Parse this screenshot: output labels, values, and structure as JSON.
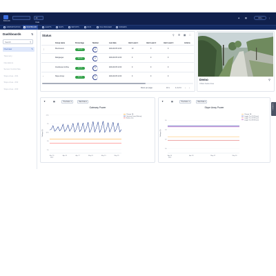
{
  "header": {
    "brand_name": "BRAND",
    "selector_value": "",
    "selector_2_value": "All Data",
    "language": "EN",
    "user_label": "FR"
  },
  "nav": {
    "items": [
      {
        "label": "ADMINISTRATION",
        "active": false
      },
      {
        "label": "DASHBOARD",
        "active": true
      },
      {
        "label": "ALERTS",
        "active": false
      },
      {
        "label": "MAPS",
        "active": false
      },
      {
        "label": "REPORTS",
        "active": false
      },
      {
        "label": "DATA",
        "active": false
      },
      {
        "label": "FILE MANAGER",
        "active": false
      },
      {
        "label": "SCREENS",
        "active": false
      }
    ]
  },
  "sidebar": {
    "title": "Dashboards",
    "search_placeholder": "Search",
    "items": [
      {
        "label": "Overview",
        "active": true
      },
      {
        "label": "Telemetry",
        "active": false
      },
      {
        "label": "Operations",
        "active": false
      },
      {
        "label": "Sensor Control Site",
        "active": false
      },
      {
        "label": "Slope Area - 001",
        "active": false
      },
      {
        "label": "Slope Area - 002",
        "active": false
      },
      {
        "label": "Slope Area - 003",
        "active": false
      }
    ]
  },
  "status": {
    "title": "Status",
    "columns": [
      "Group name",
      "Percentage",
      "Number",
      "Last data",
      "Alert Level 1",
      "Alert Level 2",
      "Alert Level 3",
      "Actions"
    ],
    "rows": [
      {
        "name": "Piezometers",
        "percentage": "100.0%",
        "number": "4/4",
        "last_data": "2022-09-05 12:00",
        "l1": "12",
        "l2": "0",
        "l3": "0"
      },
      {
        "name": "Raingauges",
        "percentage": "100.0%",
        "number": "1/1",
        "last_data": "2022-09-05 12:00",
        "l1": "0",
        "l2": "0",
        "l3": "0"
      },
      {
        "name": "Crackmeter Archive",
        "percentage": "100.0%",
        "number": "3/3",
        "last_data": "2022-09-05 12:00",
        "l1": "0",
        "l2": "0",
        "l3": "0"
      },
      {
        "name": "Slope Arrays",
        "percentage": "100.0%",
        "number": "2/2",
        "last_data": "2022-09-05 12:00",
        "l1": "0",
        "l2": "0",
        "l3": "0"
      }
    ],
    "pagination": {
      "rows_per_page_label": "Rows per page:",
      "rows_per_page": "10",
      "range": "1-4 of 4"
    }
  },
  "demo_card": {
    "title": "Demo",
    "subtitle": "Urban Aware Area"
  },
  "charts_meta": {
    "timeframe_label": "Timeframe",
    "range_label": "Raw Data",
    "feedback_tab": "Feedback"
  },
  "chart_data": [
    {
      "type": "line",
      "title": "Gateway Power",
      "ylabel": "Voltage (V)",
      "xlabel": "",
      "x_ticks": [
        "Mar 20 2022",
        "Apr 03",
        "Apr 17",
        "May 01",
        "May 15",
        "May 29"
      ],
      "y_ticks": [
        "7.5",
        "10",
        "12.5",
        "15",
        "17.5"
      ],
      "ylim": [
        6.5,
        18
      ],
      "legend_placement": "top-right",
      "series": [
        {
          "name": "Charger 1A",
          "color": "#ff9800",
          "kind": "threshold",
          "values": [
            10.5,
            10.5
          ]
        },
        {
          "name": "Gateway Power [Battery]",
          "color": "#1f3c8f",
          "kind": "series",
          "values": [
            13.2,
            13.4,
            14.4,
            12.8,
            13.3,
            14.1,
            12.9,
            13.5,
            14.8,
            12.7,
            13.4,
            14.6,
            12.8,
            13.6,
            15.1,
            12.6,
            13.5,
            15.3,
            12.7,
            13.4,
            15.2,
            12.6,
            13.7,
            15.4,
            12.5,
            13.5,
            15.6,
            12.6,
            13.8,
            15.5,
            12.5,
            13.6,
            15.7,
            12.5,
            13.4,
            15.3,
            12.6,
            13.7,
            15.4,
            12.7,
            13.5,
            15.2,
            12.6,
            13.3
          ]
        },
        {
          "name": "Battery Low",
          "color": "#ff4d4d",
          "kind": "threshold",
          "values": [
            9.4,
            9.4
          ]
        }
      ]
    },
    {
      "type": "line",
      "title": "Slope Array Power",
      "ylabel": "Voltage (V)",
      "xlabel": "",
      "x_ticks": [
        "Apr 04 2022",
        "Apr 18",
        "May 02",
        "May 16"
      ],
      "y_ticks": [
        "10",
        "12",
        "14",
        "16"
      ],
      "ylim": [
        9,
        17.5
      ],
      "legend_placement": "top-right",
      "series": [
        {
          "name": "Charger 1A",
          "color": "#ffb74d",
          "kind": "threshold",
          "values": [
            12.5,
            12.5
          ]
        },
        {
          "name": "Logger Test 1H (Power)",
          "color": "#3f4fb3",
          "kind": "series",
          "values": [
            14.8,
            14.8
          ]
        },
        {
          "name": "Logger Test 2H (Power)",
          "color": "#e57373",
          "kind": "series",
          "values": [
            11.7,
            11.7
          ]
        },
        {
          "name": "Logger Test 3H (Power)",
          "color": "#ab47bc",
          "kind": "series",
          "values": [
            14.6,
            14.6
          ]
        }
      ]
    }
  ]
}
